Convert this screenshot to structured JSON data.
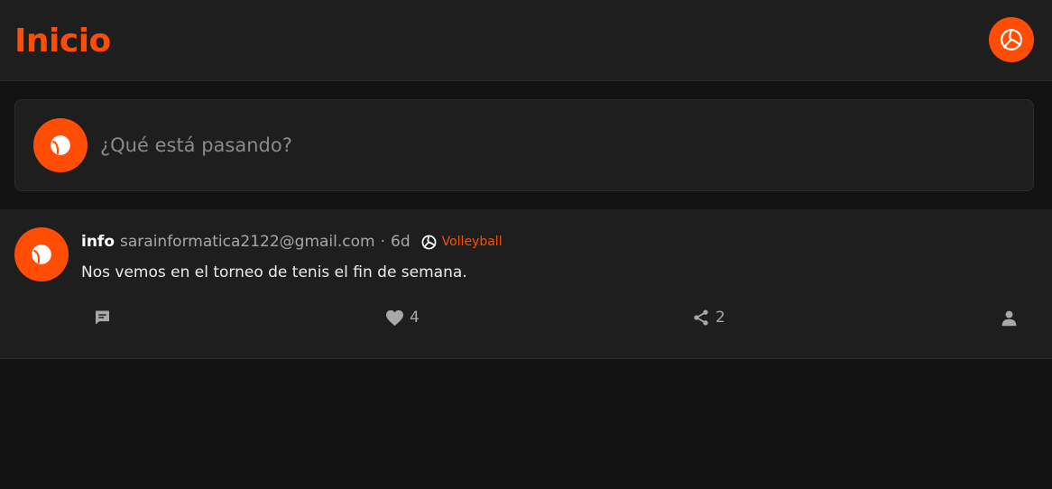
{
  "header": {
    "title": "Inicio",
    "profile_icon": "volleyball-icon"
  },
  "composer": {
    "placeholder": "¿Qué está pasando?",
    "avatar_icon": "ball-icon"
  },
  "posts": [
    {
      "author": "info",
      "email": "sarainformatica2122@gmail.com",
      "separator": "·",
      "time": "6d",
      "sport": {
        "label": "Volleyball",
        "icon": "volleyball-icon"
      },
      "text": "Nos vemos en el torneo de tenis el fin de semana.",
      "actions": {
        "comment": {
          "icon": "comment-icon",
          "count": ""
        },
        "like": {
          "icon": "heart-icon",
          "count": "4"
        },
        "share": {
          "icon": "share-icon",
          "count": "2"
        },
        "profile": {
          "icon": "user-icon"
        }
      }
    }
  ],
  "colors": {
    "accent": "#ff4d05",
    "background": "#121212",
    "surface": "#1e1e1e",
    "muted_text": "#a8a8a8"
  }
}
